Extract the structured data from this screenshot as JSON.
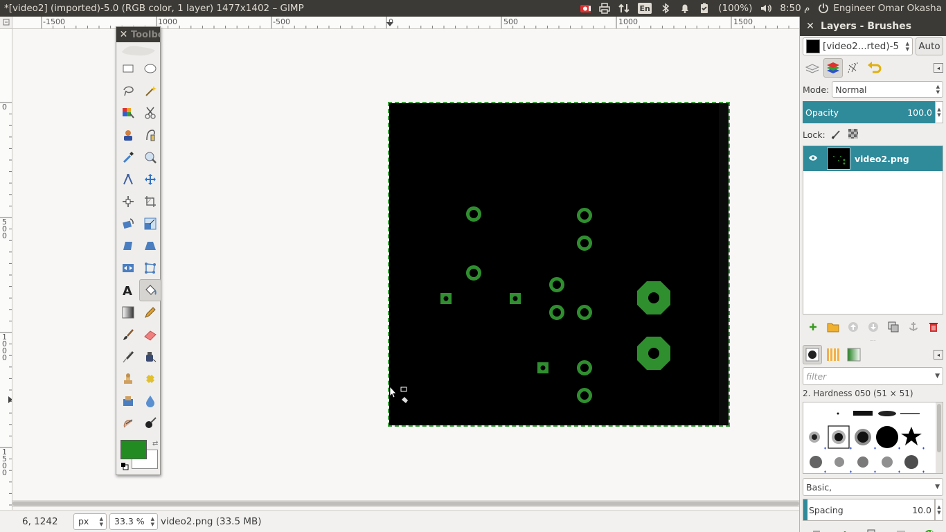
{
  "window": {
    "title": "*[video2] (imported)-5.0 (RGB color, 1 layer) 1477x1402 – GIMP"
  },
  "tray": {
    "language": "En",
    "battery": "(100%)",
    "clock": "8:50 م",
    "user": "Engineer Omar Okasha"
  },
  "rulers": {
    "h_labels": [
      "-1500",
      "1000",
      "-500",
      "0",
      "500",
      "1000",
      "1500"
    ],
    "v_labels": [
      "0",
      "500",
      "1000",
      "1500"
    ]
  },
  "toolbox": {
    "title": "Toolbox",
    "fg_color": "#228b22",
    "bg_color": "#ffffff",
    "tools": [
      "rect-select-icon",
      "ellipse-select-icon",
      "free-select-icon",
      "fuzzy-select-icon",
      "select-by-color-icon",
      "scissors-select-icon",
      "foreground-select-icon",
      "paths-icon",
      "color-picker-icon",
      "zoom-icon",
      "measure-icon",
      "move-icon",
      "align-icon",
      "crop-icon",
      "rotate-icon",
      "scale-icon",
      "shear-icon",
      "perspective-icon",
      "flip-icon",
      "cage-transform-icon",
      "text-icon",
      "bucket-fill-icon",
      "blend-icon",
      "pencil-icon",
      "paintbrush-icon",
      "eraser-icon",
      "airbrush-icon",
      "ink-icon",
      "clone-icon",
      "heal-icon",
      "perspective-clone-icon",
      "blur-sharpen-icon",
      "smudge-icon",
      "dodge-burn-icon"
    ],
    "active_tool": "bucket-fill-icon"
  },
  "status": {
    "coords": "6, 1242",
    "unit": "px",
    "zoom": "33.3 %",
    "file_info": "video2.png (33.5 MB)"
  },
  "dock": {
    "title": "Layers - Brushes",
    "image_combo": "[video2...rted)-5",
    "auto_label": "Auto",
    "mode_label": "Mode:",
    "mode_value": "Normal",
    "opacity_label": "Opacity",
    "opacity_value": "100.0",
    "lock_label": "Lock:",
    "layer_name": "video2.png",
    "filter_placeholder": "filter",
    "brush_name": "2. Hardness 050 (51 × 51)",
    "brush_tag": "Basic,",
    "spacing_label": "Spacing",
    "spacing_value": "10.0"
  },
  "colors": {
    "accent": "#2f8a9a",
    "pad_green": "#2f8f2f",
    "panel_dark": "#3b3a36"
  }
}
